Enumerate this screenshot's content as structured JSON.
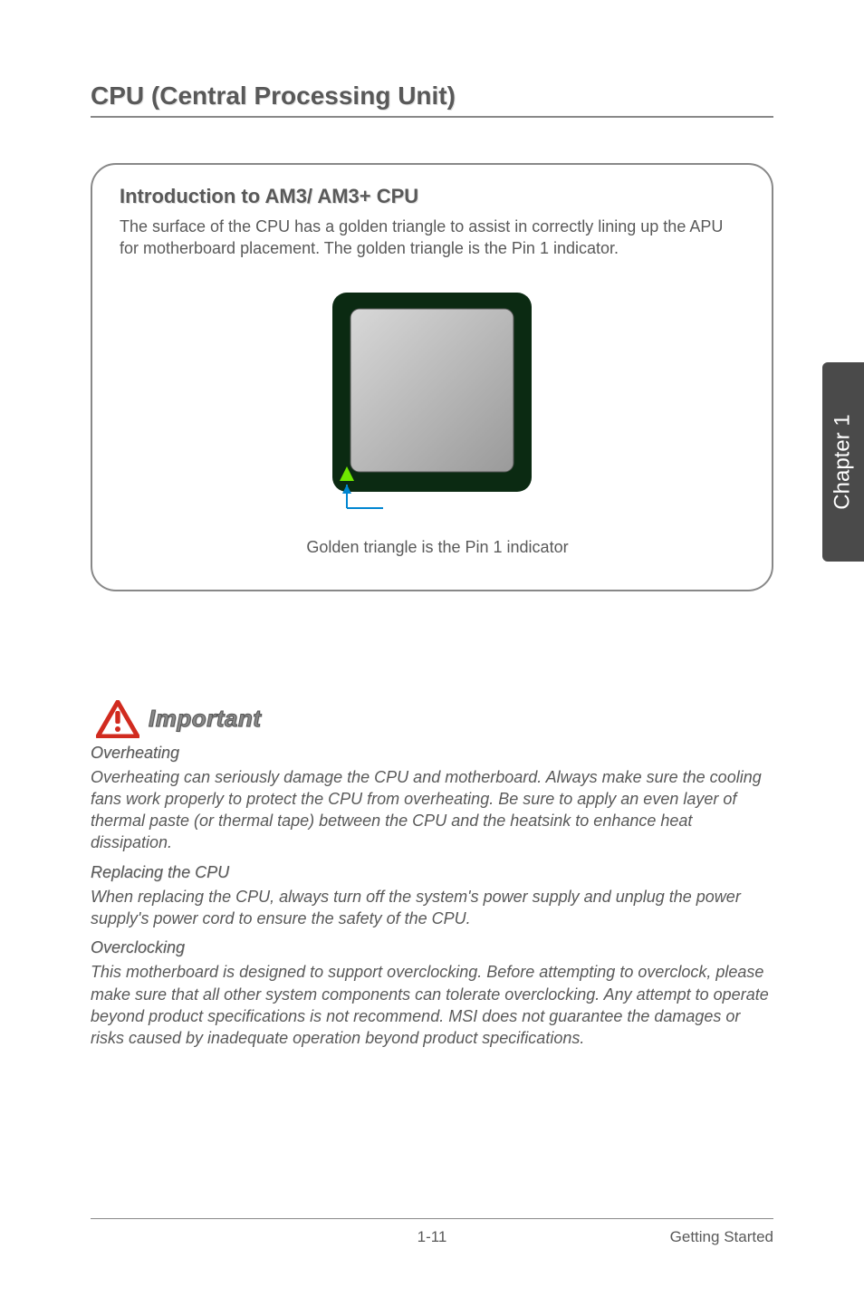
{
  "sideTab": "Chapter 1",
  "heading": "CPU (Central Processing Unit)",
  "card": {
    "title": "Introduction to AM3/ AM3+ CPU",
    "text": "The surface of the CPU has a golden triangle to assist in correctly lining up the APU for motherboard placement. The golden triangle is the Pin 1 indicator.",
    "indicatorLabel": "Golden triangle is the Pin 1 indicator"
  },
  "important": {
    "label": "Important",
    "sections": [
      {
        "title": "Overheating",
        "body": "Overheating can seriously damage the CPU and motherboard. Always make sure the cooling fans work properly to protect the CPU from overheating. Be sure to apply an even layer of thermal paste (or thermal tape) between the CPU and the heatsink to enhance heat dissipation."
      },
      {
        "title": "Replacing the CPU",
        "body": "When replacing the CPU, always turn off the system's power supply and unplug the power supply's power cord to ensure the safety of the CPU."
      },
      {
        "title": "Overclocking",
        "body": "This motherboard is designed to support overclocking. Before attempting to overclock, please make sure that all other system components can tolerate overclocking. Any attempt to operate beyond product specifications is not recommend. MSI does not guarantee the damages or risks caused by inadequate operation beyond product specifications."
      }
    ]
  },
  "footer": {
    "page": "1-11",
    "section": "Getting Started"
  }
}
